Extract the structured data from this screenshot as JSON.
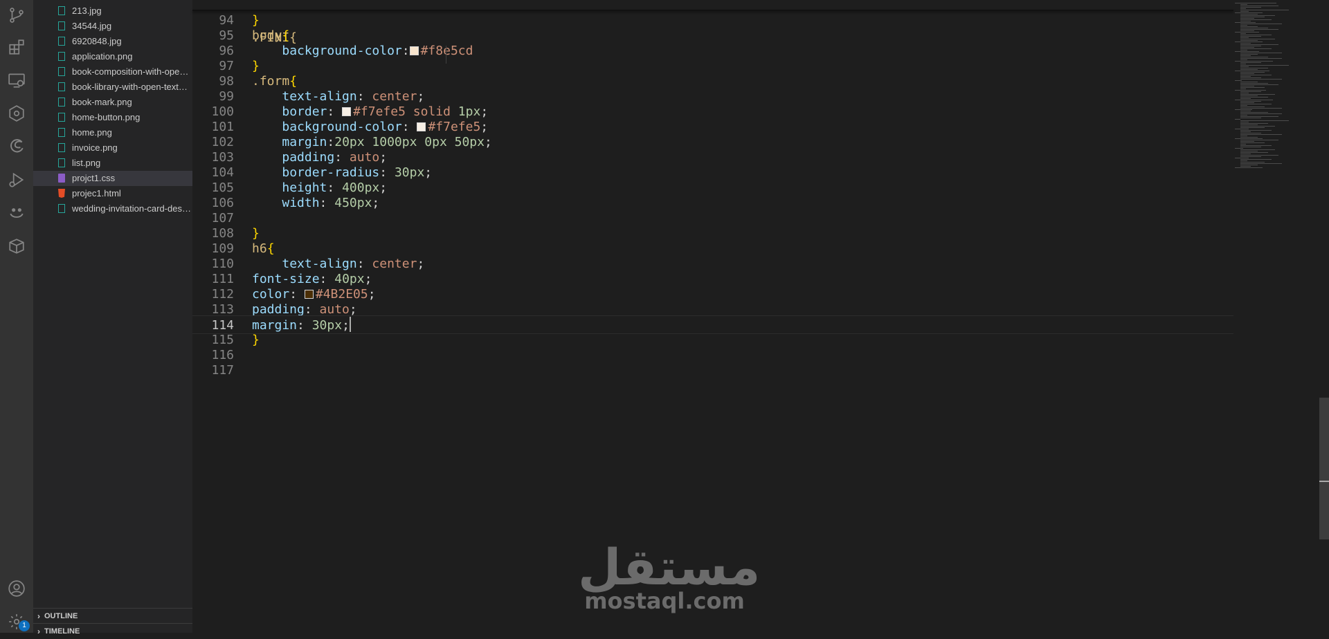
{
  "activity_bar": {
    "icons": [
      "source-control-icon",
      "extensions-icon",
      "remote-explorer-icon",
      "kubernetes-icon",
      "edge-devtools-icon",
      "run-debug-icon",
      "live-share-icon",
      "package-icon"
    ],
    "bottom_icons": [
      "account-icon",
      "settings-gear-icon"
    ],
    "settings_badge": "1"
  },
  "sidebar": {
    "files": [
      {
        "name": "213.jpg",
        "type": "image"
      },
      {
        "name": "34544.jpg",
        "type": "image"
      },
      {
        "name": "6920848.jpg",
        "type": "image"
      },
      {
        "name": "application.png",
        "type": "image"
      },
      {
        "name": "book-composition-with-open-book-and-coffee.jpg",
        "type": "image"
      },
      {
        "name": "book-library-with-open-textbook.jpg",
        "type": "image"
      },
      {
        "name": "book-mark.png",
        "type": "image"
      },
      {
        "name": "home-button.png",
        "type": "image"
      },
      {
        "name": "home.png",
        "type": "image"
      },
      {
        "name": "invoice.png",
        "type": "image"
      },
      {
        "name": "list.png",
        "type": "image"
      },
      {
        "name": "projct1.css",
        "type": "css",
        "selected": true
      },
      {
        "name": "projec1.html",
        "type": "html"
      },
      {
        "name": "wedding-invitation-card-design.png",
        "type": "image"
      }
    ],
    "outline_label": "OUTLINE",
    "timeline_label": "TIMELINE"
  },
  "editor": {
    "partial_top_line": ".FINI{",
    "lines": [
      {
        "n": "94",
        "tokens": [
          [
            "brace",
            "}"
          ]
        ]
      },
      {
        "n": "95",
        "tokens": [
          [
            "sel",
            "body"
          ],
          [
            "brace",
            "{"
          ]
        ]
      },
      {
        "n": "96",
        "tokens": [
          [
            "plain",
            "    "
          ],
          [
            "prop",
            "background-color"
          ],
          [
            "plain",
            ":"
          ],
          [
            "swatch",
            "#f8e5cd"
          ],
          [
            "val",
            "#f8e5cd"
          ]
        ]
      },
      {
        "n": "97",
        "tokens": [
          [
            "brace",
            "}"
          ]
        ]
      },
      {
        "n": "98",
        "tokens": [
          [
            "sel",
            ".form"
          ],
          [
            "brace",
            "{"
          ]
        ]
      },
      {
        "n": "99",
        "tokens": [
          [
            "plain",
            "    "
          ],
          [
            "prop",
            "text-align"
          ],
          [
            "plain",
            ": "
          ],
          [
            "val",
            "center"
          ],
          [
            "plain",
            ";"
          ]
        ]
      },
      {
        "n": "100",
        "tokens": [
          [
            "plain",
            "    "
          ],
          [
            "prop",
            "border"
          ],
          [
            "plain",
            ": "
          ],
          [
            "swatch",
            "#f7efe5"
          ],
          [
            "val",
            "#f7efe5 solid "
          ],
          [
            "num",
            "1px"
          ],
          [
            "plain",
            ";"
          ]
        ]
      },
      {
        "n": "101",
        "tokens": [
          [
            "plain",
            "    "
          ],
          [
            "prop",
            "background-color"
          ],
          [
            "plain",
            ": "
          ],
          [
            "swatch",
            "#f7efe5"
          ],
          [
            "val",
            "#f7efe5"
          ],
          [
            "plain",
            ";"
          ]
        ]
      },
      {
        "n": "102",
        "tokens": [
          [
            "plain",
            "    "
          ],
          [
            "prop",
            "margin"
          ],
          [
            "plain",
            ":"
          ],
          [
            "num",
            "20px 1000px 0px 50px"
          ],
          [
            "plain",
            ";"
          ]
        ]
      },
      {
        "n": "103",
        "tokens": [
          [
            "plain",
            "    "
          ],
          [
            "prop",
            "padding"
          ],
          [
            "plain",
            ": "
          ],
          [
            "val",
            "auto"
          ],
          [
            "plain",
            ";"
          ]
        ]
      },
      {
        "n": "104",
        "tokens": [
          [
            "plain",
            "    "
          ],
          [
            "prop",
            "border-radius"
          ],
          [
            "plain",
            ": "
          ],
          [
            "num",
            "30px"
          ],
          [
            "plain",
            ";"
          ]
        ]
      },
      {
        "n": "105",
        "tokens": [
          [
            "plain",
            "    "
          ],
          [
            "prop",
            "height"
          ],
          [
            "plain",
            ": "
          ],
          [
            "num",
            "400px"
          ],
          [
            "plain",
            ";"
          ]
        ]
      },
      {
        "n": "106",
        "tokens": [
          [
            "plain",
            "    "
          ],
          [
            "prop",
            "width"
          ],
          [
            "plain",
            ": "
          ],
          [
            "num",
            "450px"
          ],
          [
            "plain",
            ";"
          ]
        ]
      },
      {
        "n": "107",
        "tokens": []
      },
      {
        "n": "108",
        "tokens": [
          [
            "brace",
            "}"
          ]
        ]
      },
      {
        "n": "109",
        "tokens": [
          [
            "sel",
            "h6"
          ],
          [
            "brace",
            "{"
          ]
        ]
      },
      {
        "n": "110",
        "tokens": [
          [
            "plain",
            "    "
          ],
          [
            "prop",
            "text-align"
          ],
          [
            "plain",
            ": "
          ],
          [
            "val",
            "center"
          ],
          [
            "plain",
            ";"
          ]
        ]
      },
      {
        "n": "111",
        "tokens": [
          [
            "prop",
            "font-size"
          ],
          [
            "plain",
            ": "
          ],
          [
            "num",
            "40px"
          ],
          [
            "plain",
            ";"
          ]
        ]
      },
      {
        "n": "112",
        "tokens": [
          [
            "prop",
            "color"
          ],
          [
            "plain",
            ": "
          ],
          [
            "swatch",
            "#4B2E05"
          ],
          [
            "val",
            "#4B2E05"
          ],
          [
            "plain",
            ";"
          ]
        ]
      },
      {
        "n": "113",
        "tokens": [
          [
            "prop",
            "padding"
          ],
          [
            "plain",
            ": "
          ],
          [
            "val",
            "auto"
          ],
          [
            "plain",
            ";"
          ]
        ]
      },
      {
        "n": "114",
        "tokens": [
          [
            "prop",
            "margin"
          ],
          [
            "plain",
            ": "
          ],
          [
            "num",
            "30px"
          ],
          [
            "plain",
            ";"
          ],
          [
            "cursor",
            ""
          ]
        ],
        "current": true
      },
      {
        "n": "115",
        "tokens": [
          [
            "brace",
            "}"
          ]
        ]
      },
      {
        "n": "116",
        "tokens": []
      },
      {
        "n": "117",
        "tokens": []
      }
    ]
  },
  "watermark": {
    "arabic": "مستقل",
    "latin": "mostaql.com"
  },
  "colors": {
    "activity_bar": "#333333",
    "sidebar": "#252526",
    "editor": "#1e1e1e",
    "selected_file": "#37373d"
  }
}
